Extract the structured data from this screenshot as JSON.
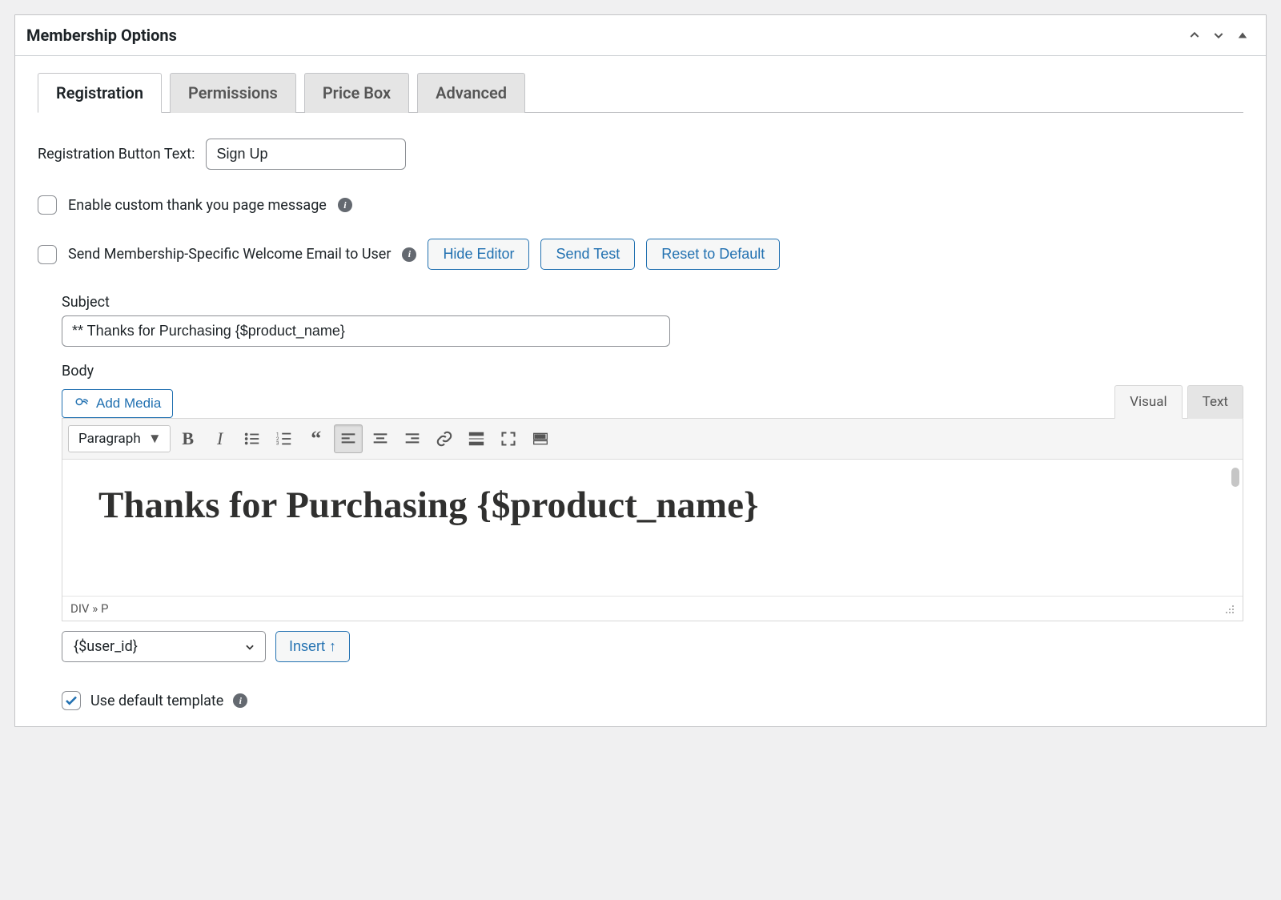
{
  "metabox": {
    "title": "Membership Options"
  },
  "tabs": [
    "Registration",
    "Permissions",
    "Price Box",
    "Advanced"
  ],
  "registration": {
    "button_text_label": "Registration Button Text:",
    "button_text_value": "Sign Up",
    "enable_thankyou_label": "Enable custom thank you page message",
    "send_welcome_label": "Send Membership-Specific Welcome Email to User",
    "hide_editor_btn": "Hide Editor",
    "send_test_btn": "Send Test",
    "reset_default_btn": "Reset to Default",
    "subject_label": "Subject",
    "subject_value": "** Thanks for Purchasing {$product_name}",
    "body_label": "Body",
    "add_media_btn": "Add Media",
    "editor_visual_tab": "Visual",
    "editor_text_tab": "Text",
    "format_select": "Paragraph",
    "editor_body_heading": "Thanks for Purchasing {$product_name}",
    "editor_path": "DIV » P",
    "variable_select": "{$user_id}",
    "insert_btn": "Insert ↑",
    "default_template_label": "Use default template"
  }
}
